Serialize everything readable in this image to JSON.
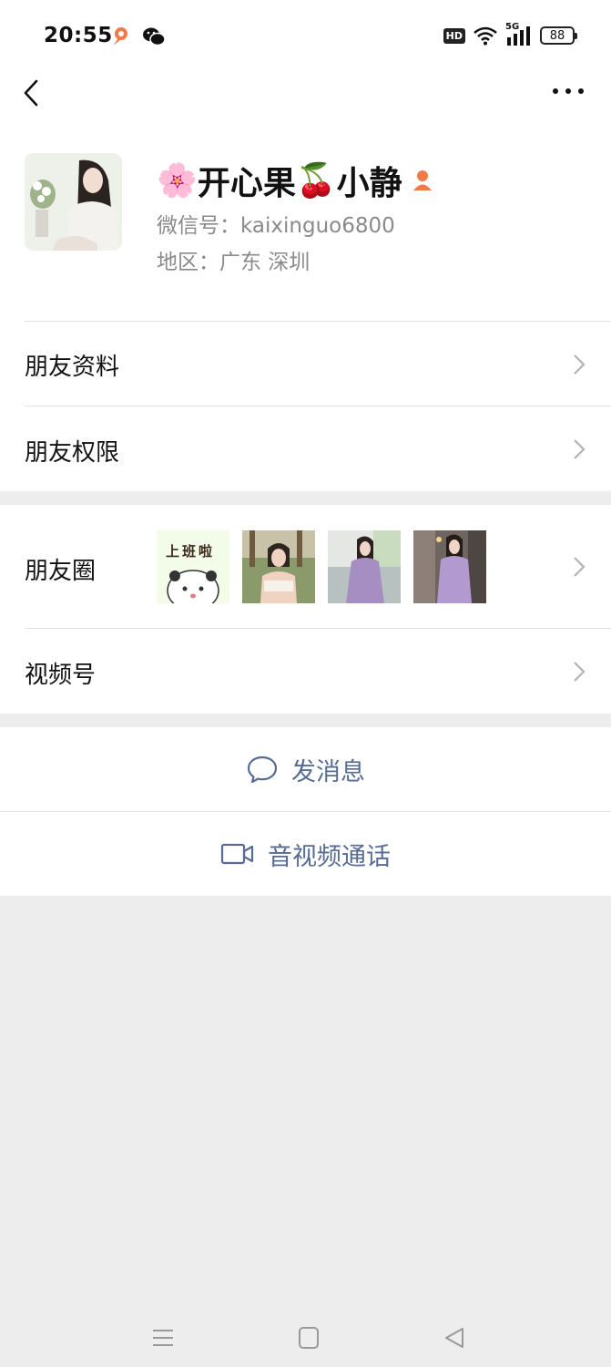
{
  "status_bar": {
    "time": "20:55",
    "hd_label": "HD",
    "network_label": "5G",
    "battery": "88",
    "icons": [
      "location-app-icon",
      "wechat-icon",
      "wifi-icon",
      "signal-icon",
      "battery-icon"
    ]
  },
  "nav": {
    "back_icon": "chevron-left-icon",
    "more_icon": "more-horizontal-icon"
  },
  "profile": {
    "nickname_emoji_start": "🌸",
    "nickname_part1": "开心果",
    "nickname_emoji_mid": "🍒",
    "nickname_part2": "小静",
    "wechat_id": "微信号：kaixinguo6800",
    "region": "地区：广东  深圳"
  },
  "menu": {
    "friend_profile": "朋友资料",
    "friend_permissions": "朋友权限",
    "moments": "朋友圈",
    "channels": "视频号"
  },
  "moments_thumbs": {
    "first_caption": "上班啦"
  },
  "actions": {
    "send_message": "发消息",
    "av_call": "音视频通话"
  },
  "colors": {
    "accent_link": "#576b95",
    "background": "#ededed",
    "badge_orange": "#f07a4a"
  }
}
